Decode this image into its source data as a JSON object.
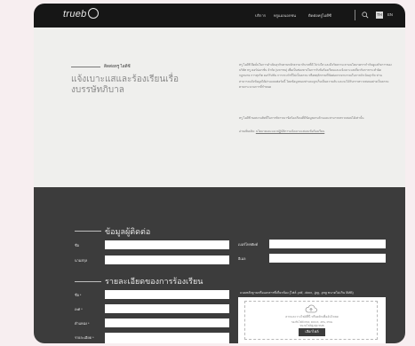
{
  "header": {
    "logo_text": "trueb",
    "nav": [
      "บริการ",
      "ทรูแอลเอกชน",
      "ติดต่อทรูไอดีซี"
    ],
    "languages": [
      "TH",
      "EN"
    ],
    "active_language": "TH"
  },
  "hero": {
    "kicker": "ติดต่อทรู ไอดีซี",
    "title": "แจ้งเบาะแสและร้องเรียนเรื่องบรรษัทภิบาล",
    "paragraphs": [
      "ทรู ไอดีซี ยึดมั่นในการดำเนินธุรกิจตามหลักธรรมาภิบาลที่ดี โปร่งใส และมีจริยธรรม ตามนโยบายการกำกับดูแลกิจการของบริษัท ทรู คอร์ปอเรชั่น จำกัด (มหาชน) เพื่อเป็นช่องทางในการรับข้อร้องเรียนและแจ้งเบาะแสเกี่ยวกับการกระทำผิดกฎหมาย การทุจริต คอร์รัปชัน การกระทำที่ไม่เป็นธรรม หรือพฤติกรรมที่ขัดต่อจรรยาบรรณในการดำเนินธุรกิจ ท่านสามารถแจ้งข้อมูลได้ผ่านแบบฟอร์มนี้ โดยข้อมูลของท่านจะถูกเก็บเป็นความลับ และจะได้รับการตรวจสอบอย่างเป็นธรรมตามกระบวนการที่กำหนด",
      "ทรู ไอดีซี ขอสงวนสิทธิ์ในการพิจารณาข้อร้องเรียนที่มีข้อมูลครบถ้วนและสามารถตรวจสอบได้เท่านั้น",
      "อ่านเพิ่มเติม: "
    ],
    "link_text": "นโยบายและแนวปฏิบัติการแจ้งเบาะแสและข้อร้องเรียน"
  },
  "form": {
    "contact_title": "ข้อมูลผู้ติดต่อ",
    "contact_fields": [
      "ชื่อ",
      "นามสกุล",
      "เบอร์โทรศัพท์",
      "อีเมล"
    ],
    "complaint_title": "รายละเอียดของการร้องเรียน",
    "complaint_fields": [
      "ชื่อ *",
      "เพศ *",
      "ตำแหน่ง *",
      "รายละเอียด *"
    ],
    "upload_label": "แนบหลักฐานหรือเอกสารที่เกี่ยวข้อง (ไฟล์ .pdf, .docx, .jpg, .png ขนาดไม่เกิน 5MB)",
    "drop_text": "ลากและวางไฟล์ที่นี่ หรือคลิกเพื่ออัปโหลด",
    "drop_subtext": "รองรับไฟล์ PDF, DOCX, JPG, PNG",
    "drop_limit": "ขนาดไฟล์สูงสุด 5MB",
    "choose_button": "เลือกไฟล์"
  },
  "colors": {
    "header_bg": "#161616",
    "hero_bg": "#efefed",
    "form_bg": "#3c3c3c",
    "page_bg": "#f7eef0"
  }
}
